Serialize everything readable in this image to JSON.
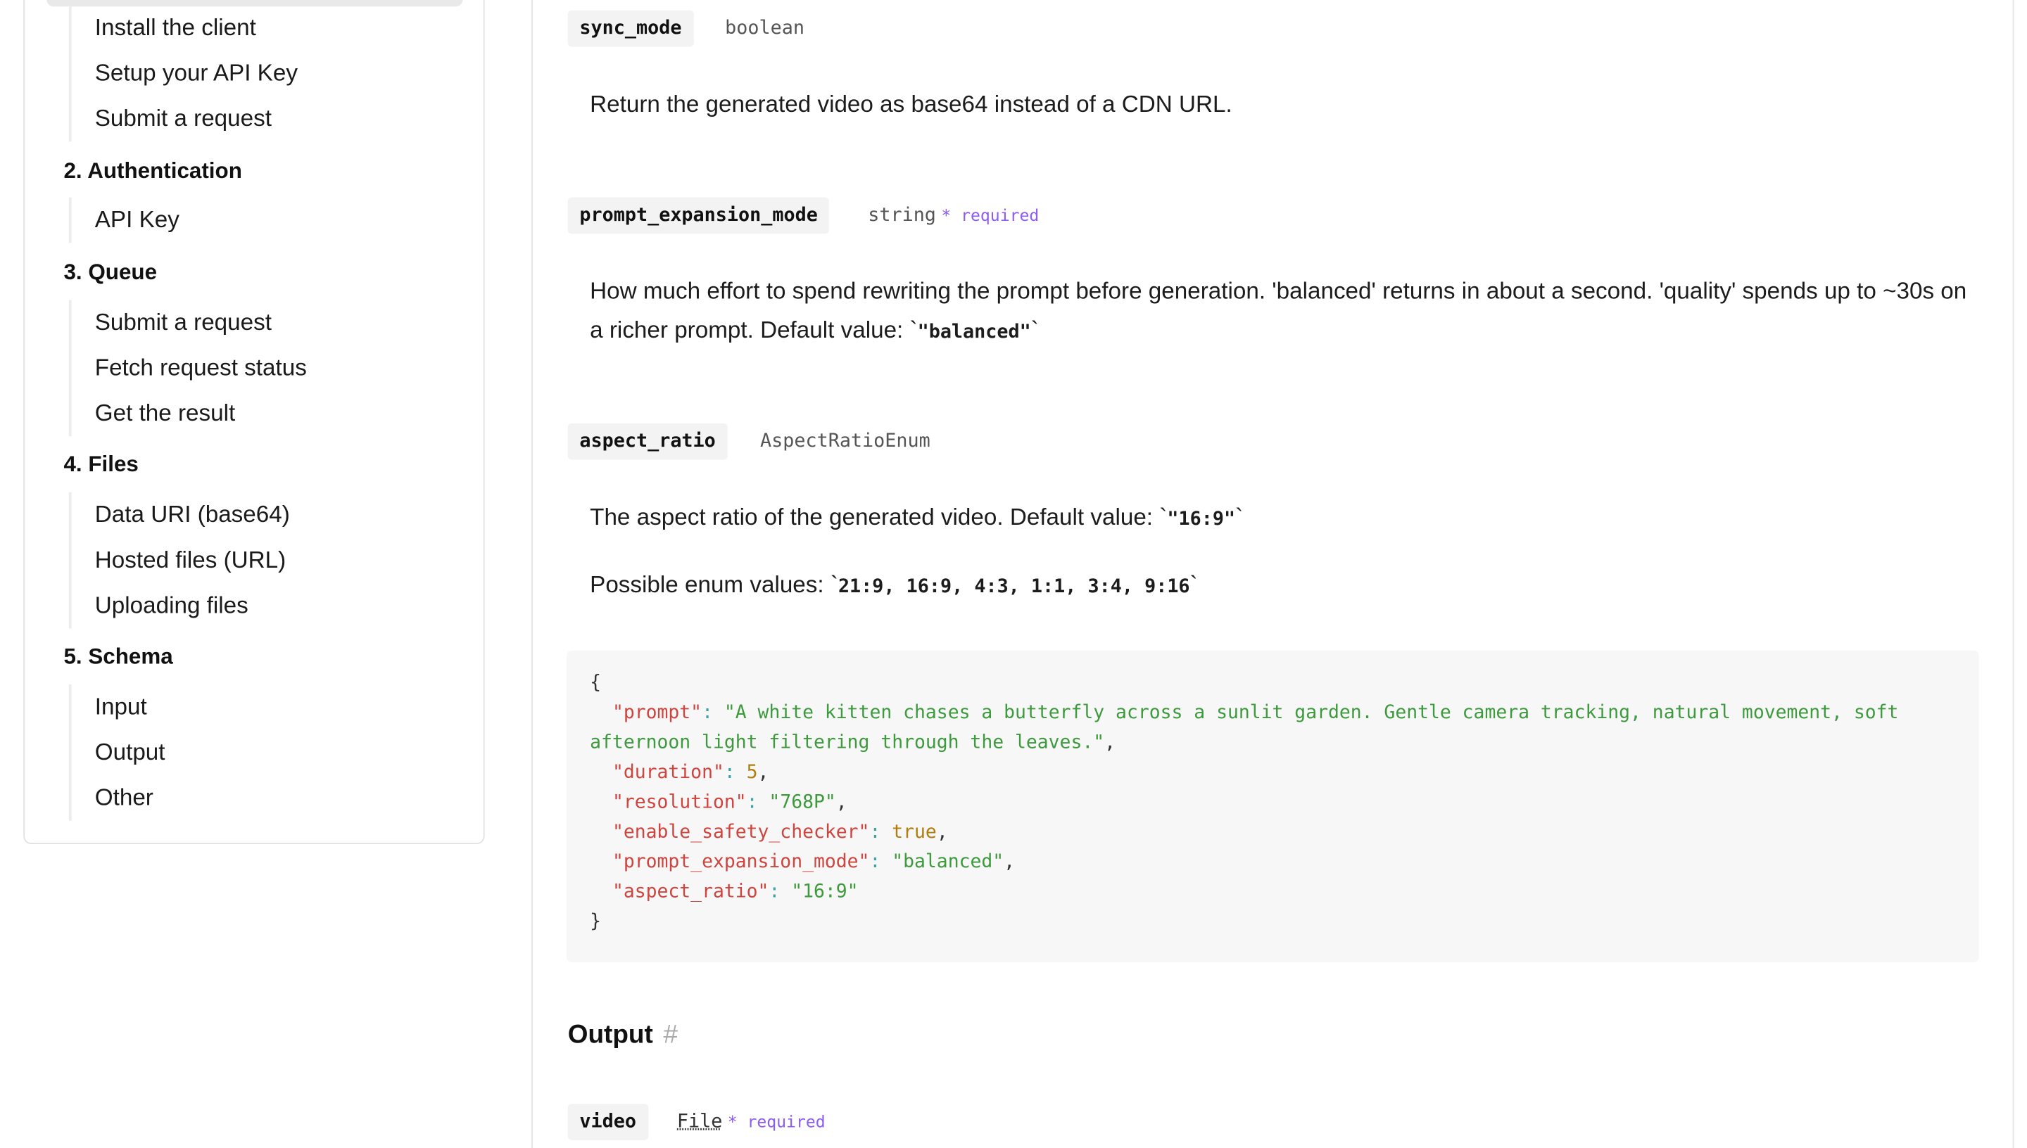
{
  "sidebar": {
    "top_items": [
      "Install the client",
      "Setup your API Key",
      "Submit a request"
    ],
    "sections": [
      {
        "title": "2. Authentication",
        "items": [
          "API Key"
        ]
      },
      {
        "title": "3. Queue",
        "items": [
          "Submit a request",
          "Fetch request status",
          "Get the result"
        ]
      },
      {
        "title": "4. Files",
        "items": [
          "Data URI (base64)",
          "Hosted files (URL)",
          "Uploading files"
        ]
      },
      {
        "title": "5. Schema",
        "items": [
          "Input",
          "Output",
          "Other"
        ]
      }
    ]
  },
  "params": {
    "sync_mode": {
      "name": "sync_mode",
      "type": "boolean",
      "description": "Return the generated video as base64 instead of a CDN URL."
    },
    "prompt_expansion_mode": {
      "name": "prompt_expansion_mode",
      "type": "string",
      "required_label": "* required",
      "description": "How much effort to spend rewriting the prompt before generation. 'balanced' returns in about a second. 'quality' spends up to ~30s on a richer prompt. Default value: `",
      "default_value": "\"balanced\"",
      "tick": "`"
    },
    "aspect_ratio": {
      "name": "aspect_ratio",
      "type": "AspectRatioEnum",
      "description": "The aspect ratio of the generated video. Default value: `",
      "default_value": "\"16:9\"",
      "tick": "`",
      "enum_label": "Possible enum values: `",
      "enum_values": "21:9, 16:9, 4:3, 1:1, 3:4, 9:16"
    }
  },
  "code": {
    "open": "{",
    "close": "}",
    "lines": [
      {
        "key": "\"prompt\"",
        "value": "\"A white kitten chases a butterfly across a sunlit garden. Gentle camera tracking, natural movement, soft afternoon light filtering through the leaves.\"",
        "kind": "s"
      },
      {
        "key": "\"duration\"",
        "value": "5",
        "kind": "n"
      },
      {
        "key": "\"resolution\"",
        "value": "\"768P\"",
        "kind": "s"
      },
      {
        "key": "\"enable_safety_checker\"",
        "value": "true",
        "kind": "n"
      },
      {
        "key": "\"prompt_expansion_mode\"",
        "value": "\"balanced\"",
        "kind": "s"
      },
      {
        "key": "\"aspect_ratio\"",
        "value": "\"16:9\"",
        "kind": "s"
      }
    ]
  },
  "output": {
    "heading": "Output",
    "hash": "#",
    "video": {
      "name": "video",
      "type": "File",
      "required_label": "* required"
    }
  },
  "colors": {
    "required": "#8b5cf6",
    "code_key": "#d0443e",
    "code_string": "#3d9a3d",
    "code_number": "#b07d0e"
  }
}
